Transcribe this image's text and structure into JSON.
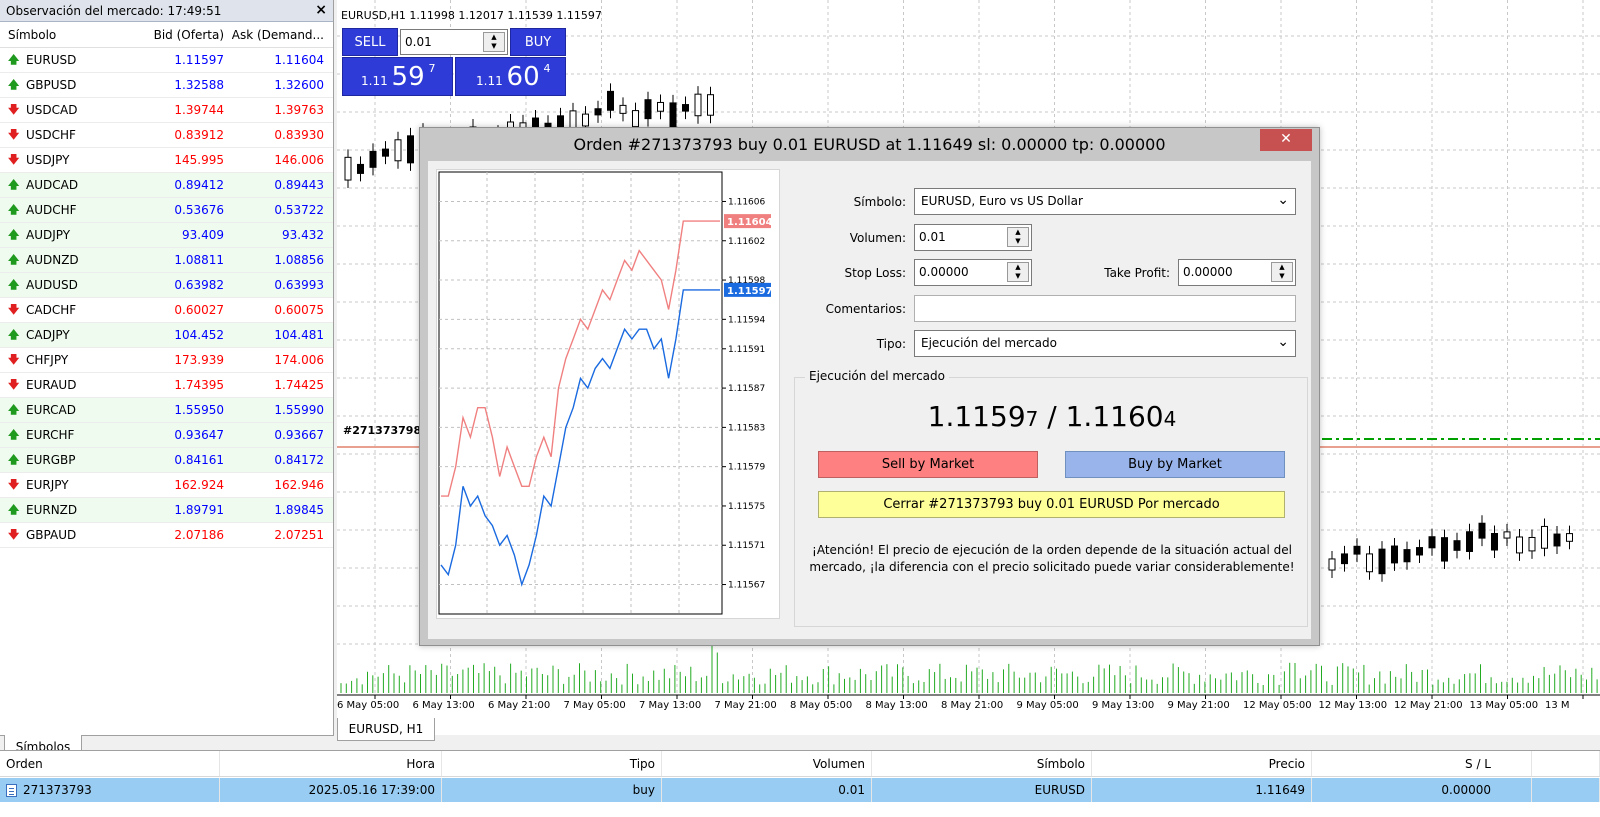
{
  "market_watch": {
    "title": "Observación del mercado: 17:49:51",
    "close_glyph": "×",
    "col_symbol": "Símbolo",
    "col_bid": "Bid (Oferta)",
    "col_ask": "Ask (Demand...",
    "rows": [
      {
        "symbol": "EURUSD",
        "bid": "1.11597",
        "ask": "1.11604",
        "dir": "up",
        "bid_color": "blue",
        "ask_color": "blue"
      },
      {
        "symbol": "GBPUSD",
        "bid": "1.32588",
        "ask": "1.32600",
        "dir": "up",
        "bid_color": "blue",
        "ask_color": "blue"
      },
      {
        "symbol": "USDCAD",
        "bid": "1.39744",
        "ask": "1.39763",
        "dir": "down",
        "bid_color": "red",
        "ask_color": "red"
      },
      {
        "symbol": "USDCHF",
        "bid": "0.83912",
        "ask": "0.83930",
        "dir": "down",
        "bid_color": "red",
        "ask_color": "red"
      },
      {
        "symbol": "USDJPY",
        "bid": "145.995",
        "ask": "146.006",
        "dir": "down",
        "bid_color": "red",
        "ask_color": "red"
      },
      {
        "symbol": "AUDCAD",
        "bid": "0.89412",
        "ask": "0.89443",
        "dir": "up",
        "bid_color": "blue",
        "ask_color": "blue"
      },
      {
        "symbol": "AUDCHF",
        "bid": "0.53676",
        "ask": "0.53722",
        "dir": "up",
        "bid_color": "blue",
        "ask_color": "blue"
      },
      {
        "symbol": "AUDJPY",
        "bid": "93.409",
        "ask": "93.432",
        "dir": "up",
        "bid_color": "blue",
        "ask_color": "blue"
      },
      {
        "symbol": "AUDNZD",
        "bid": "1.08811",
        "ask": "1.08856",
        "dir": "up",
        "bid_color": "blue",
        "ask_color": "blue"
      },
      {
        "symbol": "AUDUSD",
        "bid": "0.63982",
        "ask": "0.63993",
        "dir": "up",
        "bid_color": "blue",
        "ask_color": "blue"
      },
      {
        "symbol": "CADCHF",
        "bid": "0.60027",
        "ask": "0.60075",
        "dir": "down",
        "bid_color": "red",
        "ask_color": "red"
      },
      {
        "symbol": "CADJPY",
        "bid": "104.452",
        "ask": "104.481",
        "dir": "up",
        "bid_color": "blue",
        "ask_color": "blue"
      },
      {
        "symbol": "CHFJPY",
        "bid": "173.939",
        "ask": "174.006",
        "dir": "down",
        "bid_color": "red",
        "ask_color": "red"
      },
      {
        "symbol": "EURAUD",
        "bid": "1.74395",
        "ask": "1.74425",
        "dir": "down",
        "bid_color": "red",
        "ask_color": "red"
      },
      {
        "symbol": "EURCAD",
        "bid": "1.55950",
        "ask": "1.55990",
        "dir": "up",
        "bid_color": "blue",
        "ask_color": "blue"
      },
      {
        "symbol": "EURCHF",
        "bid": "0.93647",
        "ask": "0.93667",
        "dir": "up",
        "bid_color": "blue",
        "ask_color": "blue"
      },
      {
        "symbol": "EURGBP",
        "bid": "0.84161",
        "ask": "0.84172",
        "dir": "up",
        "bid_color": "blue",
        "ask_color": "blue"
      },
      {
        "symbol": "EURJPY",
        "bid": "162.924",
        "ask": "162.946",
        "dir": "down",
        "bid_color": "red",
        "ask_color": "red"
      },
      {
        "symbol": "EURNZD",
        "bid": "1.89791",
        "ask": "1.89845",
        "dir": "up",
        "bid_color": "blue",
        "ask_color": "blue"
      },
      {
        "symbol": "GBPAUD",
        "bid": "2.07186",
        "ask": "2.07251",
        "dir": "down",
        "bid_color": "red",
        "ask_color": "red"
      }
    ],
    "tab_label": "Símbolos"
  },
  "chart": {
    "symbol_line": "EURUSD,H1  1.11998 1.12017 1.11539 1.11597",
    "sell_label": "SELL",
    "buy_label": "BUY",
    "volume": "0.01",
    "sell_price_prefix": "1.11",
    "sell_price_big": "59",
    "sell_price_sup": "7",
    "buy_price_prefix": "1.11",
    "buy_price_big": "60",
    "buy_price_sup": "4",
    "order_tag": "#271373798",
    "x_labels": [
      "6 May 05:00",
      "6 May 13:00",
      "6 May 21:00",
      "7 May 05:00",
      "7 May 13:00",
      "7 May 21:00",
      "8 May 05:00",
      "8 May 13:00",
      "8 May 21:00",
      "9 May 05:00",
      "9 May 13:00",
      "9 May 21:00",
      "12 May 05:00",
      "12 May 13:00",
      "12 May 21:00",
      "13 May 05:00",
      "13 M"
    ],
    "tab_label": "EURUSD, H1",
    "line_colors": {
      "order": "#e8a090",
      "green_dash": "#00a000"
    }
  },
  "dialog": {
    "title": "Orden #271373793 buy 0.01 EURUSD at 1.11649 sl: 0.00000 tp: 0.00000",
    "close_glyph": "✕",
    "symbol_label": "Símbolo:",
    "symbol_value": "EURUSD, Euro vs US Dollar",
    "volume_label": "Volumen:",
    "volume_value": "0.01",
    "sl_label": "Stop Loss:",
    "sl_value": "0.00000",
    "tp_label": "Take Profit:",
    "tp_value": "0.00000",
    "comment_label": "Comentarios:",
    "comment_value": "",
    "type_label": "Tipo:",
    "type_value": "Ejecución del mercado",
    "group_label": "Ejecución del mercado",
    "price_bid_main": "1.1159",
    "price_bid_last": "7",
    "price_sep": " / ",
    "price_ask_main": "1.1160",
    "price_ask_last": "4",
    "sell_btn": "Sell by Market",
    "buy_btn": "Buy by Market",
    "close_btn": "Cerrar #271373793 buy 0.01 EURUSD Por mercado",
    "warning": "¡Atención! El precio de ejecución de la orden depende de la situación actual del mercado, ¡la diferencia con el precio solicitado puede variar considerablemente!",
    "tick_chart": {
      "y_ticks": [
        "1.11606",
        "1.11602",
        "1.11598",
        "1.11594",
        "1.11591",
        "1.11587",
        "1.11583",
        "1.11579",
        "1.11575",
        "1.11571",
        "1.11567"
      ],
      "y_tick_values": [
        1.11606,
        1.11602,
        1.11598,
        1.11594,
        1.11591,
        1.11587,
        1.11583,
        1.11579,
        1.11575,
        1.11571,
        1.11567
      ],
      "ask_label": "1.11604",
      "bid_label": "1.11597",
      "ask_color": "#f08080",
      "bid_color": "#1a6ae0",
      "ask": [
        1.11576,
        1.11576,
        1.11579,
        1.11584,
        1.11582,
        1.11585,
        1.11585,
        1.11582,
        1.11578,
        1.11581,
        1.11579,
        1.11577,
        1.11577,
        1.1158,
        1.11582,
        1.1158,
        1.11587,
        1.1159,
        1.11592,
        1.11594,
        1.11593,
        1.11595,
        1.11597,
        1.11596,
        1.11598,
        1.116,
        1.11599,
        1.11601,
        1.116,
        1.11599,
        1.11598,
        1.11595,
        1.11599,
        1.11604,
        1.11604,
        1.11604,
        1.11604,
        1.11604,
        1.11604
      ],
      "bid": [
        1.11569,
        1.11568,
        1.11571,
        1.11577,
        1.11575,
        1.11576,
        1.11574,
        1.11573,
        1.11571,
        1.11572,
        1.1157,
        1.11567,
        1.11569,
        1.11572,
        1.11576,
        1.11575,
        1.11579,
        1.11583,
        1.11585,
        1.11588,
        1.11587,
        1.11589,
        1.1159,
        1.11589,
        1.11591,
        1.11593,
        1.11592,
        1.11593,
        1.11593,
        1.11591,
        1.11592,
        1.11588,
        1.11592,
        1.11597,
        1.11597,
        1.11597,
        1.11597,
        1.11597,
        1.11597
      ]
    }
  },
  "terminal": {
    "headers": {
      "order": "Orden",
      "time": "Hora",
      "type": "Tipo",
      "volume": "Volumen",
      "symbol": "Símbolo",
      "price": "Precio",
      "sl": "S / L"
    },
    "row": {
      "order": "271373793",
      "time": "2025.05.16 17:39:00",
      "type": "buy",
      "volume": "0.01",
      "symbol": "EURUSD",
      "price": "1.11649",
      "sl": "0.00000"
    }
  }
}
